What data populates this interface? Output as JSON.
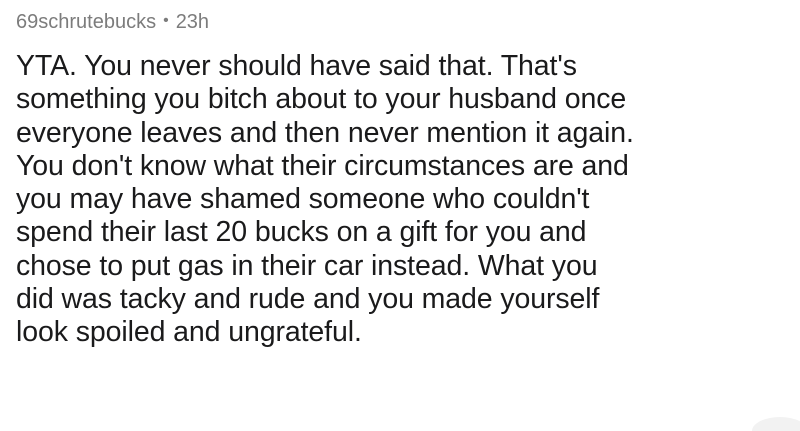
{
  "comment": {
    "username": "69schrutebucks",
    "separator": "•",
    "age": "23h",
    "lines": [
      "YTA. You never should have said that. That's",
      "something you bitch about to your husband once",
      "everyone leaves and then never mention it again.",
      "You don't know what their circumstances are and",
      "you may have shamed someone who couldn't",
      "spend their last 20 bucks on a gift for you and",
      "chose to put gas in their car instead. What you",
      "did was tacky and rude and you made yourself",
      "look spoiled and ungrateful."
    ]
  },
  "colors": {
    "meta_text": "#7c7c7c",
    "body_text": "#1a1a1b",
    "background": "#ffffff"
  }
}
